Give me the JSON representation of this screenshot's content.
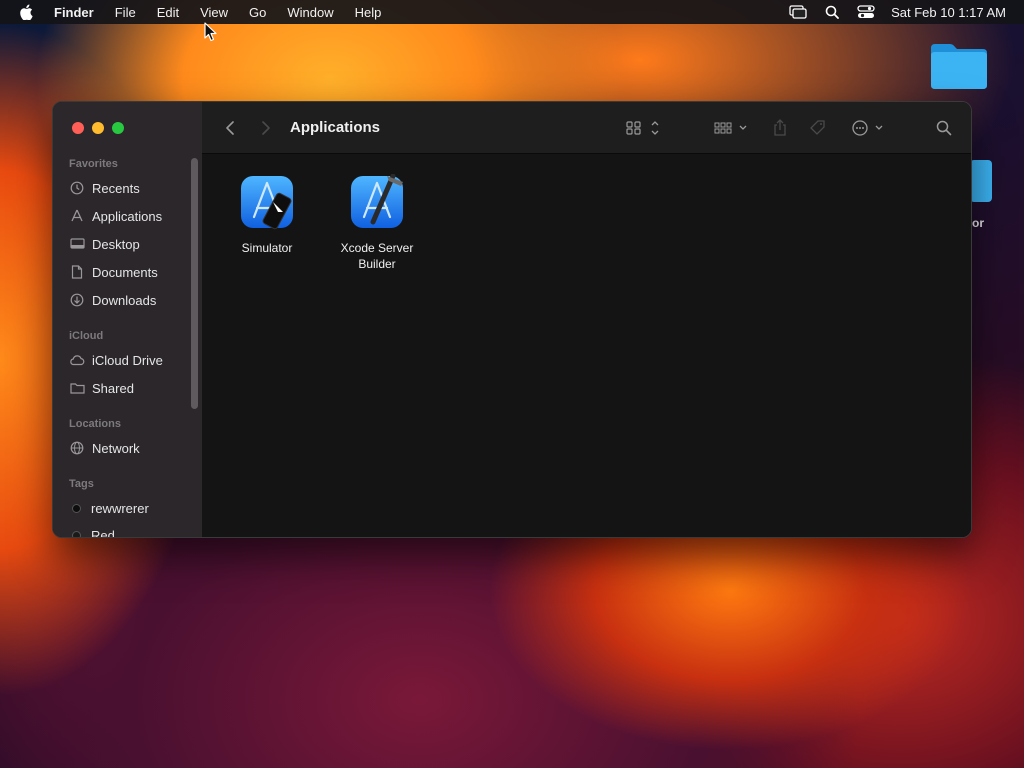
{
  "menubar": {
    "app_name": "Finder",
    "items": [
      "File",
      "Edit",
      "View",
      "Go",
      "Window",
      "Help"
    ],
    "clock": "Sat Feb 10  1:17 AM"
  },
  "desktop": {
    "partial_label": "or"
  },
  "finder": {
    "title": "Applications",
    "sidebar": {
      "favorites_header": "Favorites",
      "favorites": [
        {
          "label": "Recents",
          "icon": "clock-icon"
        },
        {
          "label": "Applications",
          "icon": "applications-icon"
        },
        {
          "label": "Desktop",
          "icon": "desktop-icon"
        },
        {
          "label": "Documents",
          "icon": "document-icon"
        },
        {
          "label": "Downloads",
          "icon": "download-icon"
        }
      ],
      "icloud_header": "iCloud",
      "icloud": [
        {
          "label": "iCloud Drive",
          "icon": "cloud-icon"
        },
        {
          "label": "Shared",
          "icon": "shared-folder-icon"
        }
      ],
      "locations_header": "Locations",
      "locations": [
        {
          "label": "Network",
          "icon": "globe-icon"
        }
      ],
      "tags_header": "Tags",
      "tags": [
        {
          "label": "rewwrerer"
        },
        {
          "label": "Red"
        }
      ]
    },
    "files": [
      {
        "name": "Simulator"
      },
      {
        "name": "Xcode Server Builder"
      }
    ]
  }
}
